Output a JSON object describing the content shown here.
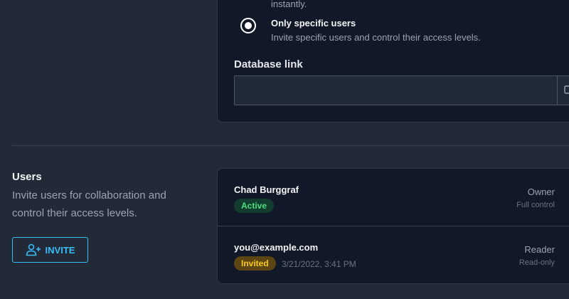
{
  "access": {
    "fragment_text": "instantly.",
    "option_title": "Only specific users",
    "option_description": "Invite specific users and control their access levels.",
    "option_selected": true
  },
  "database_link": {
    "label": "Database link",
    "value": "",
    "copy_icon": "copy-icon"
  },
  "users_section": {
    "title": "Users",
    "description": "Invite users for collaboration and control their access levels.",
    "invite_label": "INVITE",
    "invite_icon": "user-plus-icon"
  },
  "users": [
    {
      "name": "Chad Burggraf",
      "status": "Active",
      "date": "",
      "role": "Owner",
      "permission": "Full control"
    },
    {
      "name": "you@example.com",
      "status": "Invited",
      "date": "3/21/2022, 3:41 PM",
      "role": "Reader",
      "permission": "Read-only"
    }
  ],
  "colors": {
    "background": "#222a37",
    "card": "#111827",
    "accent": "#38bdf8",
    "active_badge": "#4ade80",
    "invited_badge": "#facc15"
  }
}
